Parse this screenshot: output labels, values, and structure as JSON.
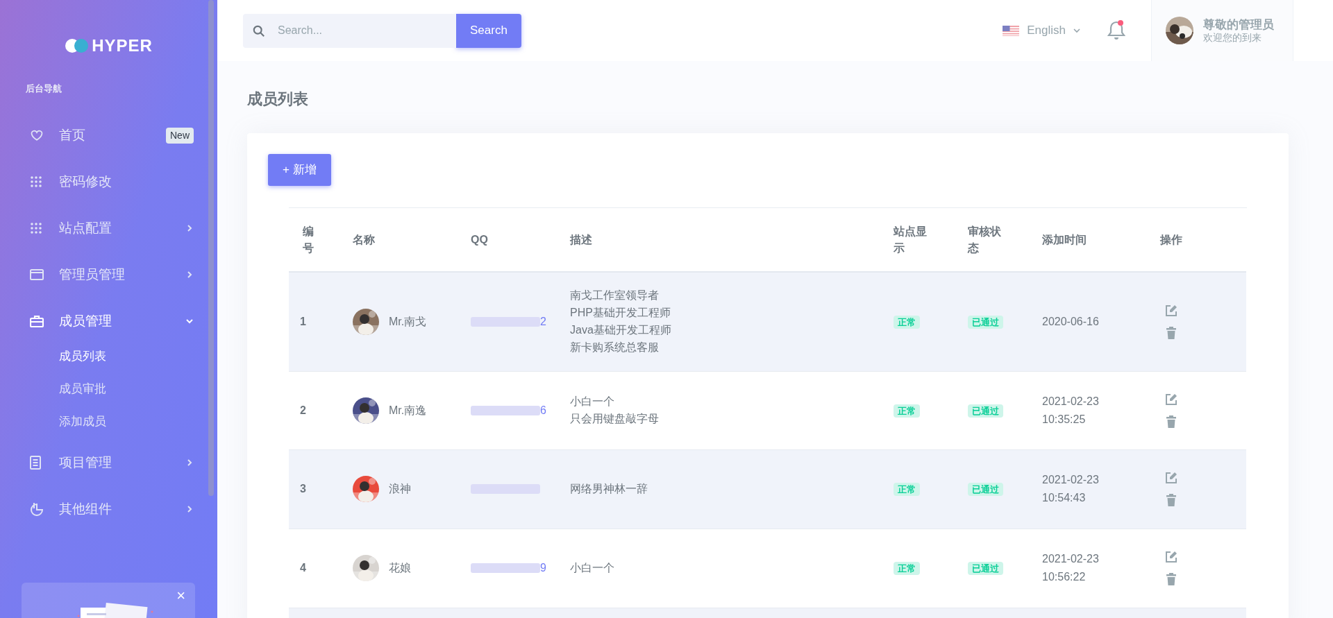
{
  "brand": "HYPER",
  "sidebar": {
    "heading": "后台导航",
    "items": [
      {
        "kind": "heart",
        "label": "首页",
        "badge": "New",
        "expanded": false,
        "has_children": false
      },
      {
        "kind": "grid",
        "label": "密码修改",
        "expanded": false,
        "has_children": false
      },
      {
        "kind": "grid",
        "label": "站点配置",
        "expanded": false,
        "has_children": true
      },
      {
        "kind": "window",
        "label": "管理员管理",
        "expanded": false,
        "has_children": true
      },
      {
        "kind": "briefcase",
        "label": "成员管理",
        "expanded": true,
        "has_children": true,
        "children": [
          {
            "label": "成员列表",
            "selected": true
          },
          {
            "label": "成员审批",
            "selected": false
          },
          {
            "label": "添加成员",
            "selected": false
          }
        ]
      },
      {
        "kind": "document",
        "label": "项目管理",
        "expanded": false,
        "has_children": true
      },
      {
        "kind": "pie",
        "label": "其他组件",
        "expanded": false,
        "has_children": true
      }
    ],
    "promo": {
      "close": "×"
    }
  },
  "topbar": {
    "search": {
      "placeholder": "Search...",
      "button": "Search"
    },
    "language": "English",
    "notifications": true,
    "user": {
      "name": "尊敬的管理员",
      "subtitle": "欢迎您的到来"
    }
  },
  "page_title": "成员列表",
  "add_button": "+ 新增",
  "table": {
    "columns": [
      "编号",
      "名称",
      "QQ",
      "描述",
      "站点显示",
      "审核状态",
      "添加时间",
      "操作"
    ],
    "rows": [
      {
        "id": "1",
        "name": "Mr.南戈",
        "qq_visible": "2",
        "description": [
          "南戈工作室领导者",
          "PHP基础开发工程师",
          "Java基础开发工程师",
          "新卡购系统总客服"
        ],
        "site": "正常",
        "review": "已通过",
        "added": [
          "2020-06-16"
        ]
      },
      {
        "id": "2",
        "name": "Mr.南逸",
        "qq_visible": "6",
        "description": [
          "小白一个",
          "只会用键盘敲字母"
        ],
        "site": "正常",
        "review": "已通过",
        "added": [
          "2021-02-23",
          "10:35:25"
        ]
      },
      {
        "id": "3",
        "name": "浪神",
        "description": [
          "网络男神林一辞"
        ],
        "site": "正常",
        "review": "已通过",
        "added": [
          "2021-02-23",
          "10:54:43"
        ]
      },
      {
        "id": "4",
        "name": "花娘",
        "qq_visible": "9",
        "description": [
          "小白一个"
        ],
        "site": "正常",
        "review": "已通过",
        "added": [
          "2021-02-23",
          "10:56:22"
        ]
      }
    ]
  }
}
